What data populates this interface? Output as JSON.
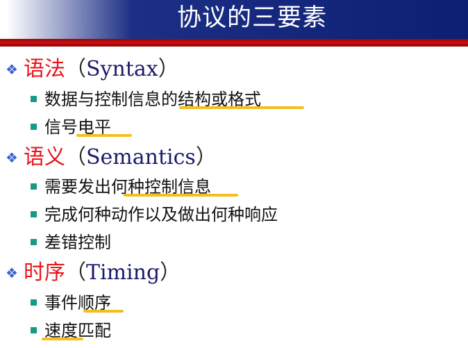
{
  "slide": {
    "title": "协议的三要素",
    "sections": [
      {
        "name_cn": "语法",
        "open_paren": "（",
        "name_en": "Syntax",
        "close_paren": "）",
        "items": [
          "数据与控制信息的结构或格式",
          "信号电平"
        ]
      },
      {
        "name_cn": "语义",
        "open_paren": "（",
        "name_en": "Semantics",
        "close_paren": "）",
        "items": [
          "需要发出何种控制信息",
          "完成何种动作以及做出何种响应",
          "差错控制"
        ]
      },
      {
        "name_cn": "时序",
        "open_paren": "（",
        "name_en": "Timing",
        "close_paren": "）",
        "items": [
          "事件顺序",
          "速度匹配"
        ]
      }
    ]
  },
  "colors": {
    "header_blue": "#0b1f73",
    "header_red": "#c81010",
    "heading_red": "#e8121a",
    "diamond_blue": "#3a5fd0",
    "bullet_teal": "#159a8a",
    "highlight_yellow": "#f4bf1e"
  },
  "icons": {
    "section_marker": "diamond-cluster-icon",
    "item_marker": "square-bullet-icon"
  }
}
